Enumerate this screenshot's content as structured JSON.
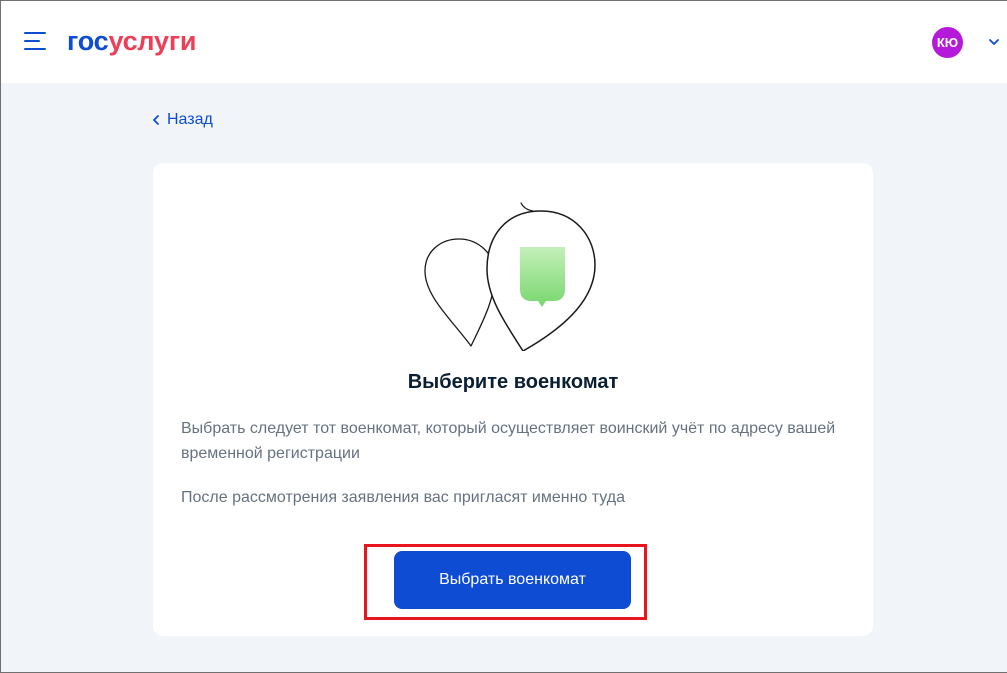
{
  "header": {
    "menu_icon": "hamburger-menu-icon",
    "logo_part1": "гос",
    "logo_part2": "услуги",
    "avatar_initials": "КЮ",
    "avatar_color": "#b519d9",
    "chevron_icon": "chevron-down-icon"
  },
  "nav": {
    "back_label": "Назад",
    "back_icon": "chevron-left-icon"
  },
  "card": {
    "illustration_icon": "map-pins-illustration",
    "title": "Выберите военкомат",
    "description_line1": "Выбрать следует тот военкомат, который осуществляет воинский учёт по адресу вашей временной регистрации",
    "description_line2": "После рассмотрения заявления вас пригласят именно туда",
    "button_label": "Выбрать военкомат"
  },
  "colors": {
    "brand_blue": "#0d4cd3",
    "brand_red": "#ee3f58",
    "page_bg": "#f1f4f9",
    "highlight_red": "#e8151e"
  }
}
